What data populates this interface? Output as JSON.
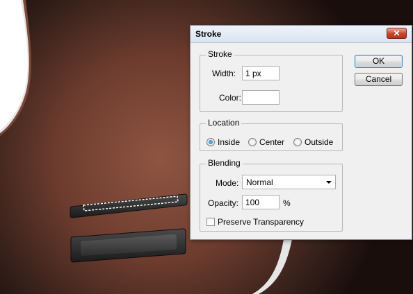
{
  "dialog": {
    "title": "Stroke",
    "close_glyph": "✕",
    "stroke_group": {
      "legend": "Stroke",
      "width_label": "Width:",
      "width_value": "1 px",
      "color_label": "Color:",
      "color_value": "#ffffff"
    },
    "location_group": {
      "legend": "Location",
      "options": [
        "Inside",
        "Center",
        "Outside"
      ],
      "selected": "Inside"
    },
    "blending_group": {
      "legend": "Blending",
      "mode_label": "Mode:",
      "mode_value": "Normal",
      "opacity_label": "Opacity:",
      "opacity_value": "100",
      "opacity_unit": "%",
      "preserve_label": "Preserve Transparency",
      "preserve_checked": false
    },
    "buttons": {
      "ok": "OK",
      "cancel": "Cancel"
    }
  },
  "canvas": {
    "subject": "guitar-body",
    "selection": "marching-ants-selection",
    "colors": {
      "body_highlight": "#8f5542",
      "body_dark": "#1a0e0c",
      "rim": "#eaeaea",
      "bridge": "#2b2b2b"
    }
  }
}
